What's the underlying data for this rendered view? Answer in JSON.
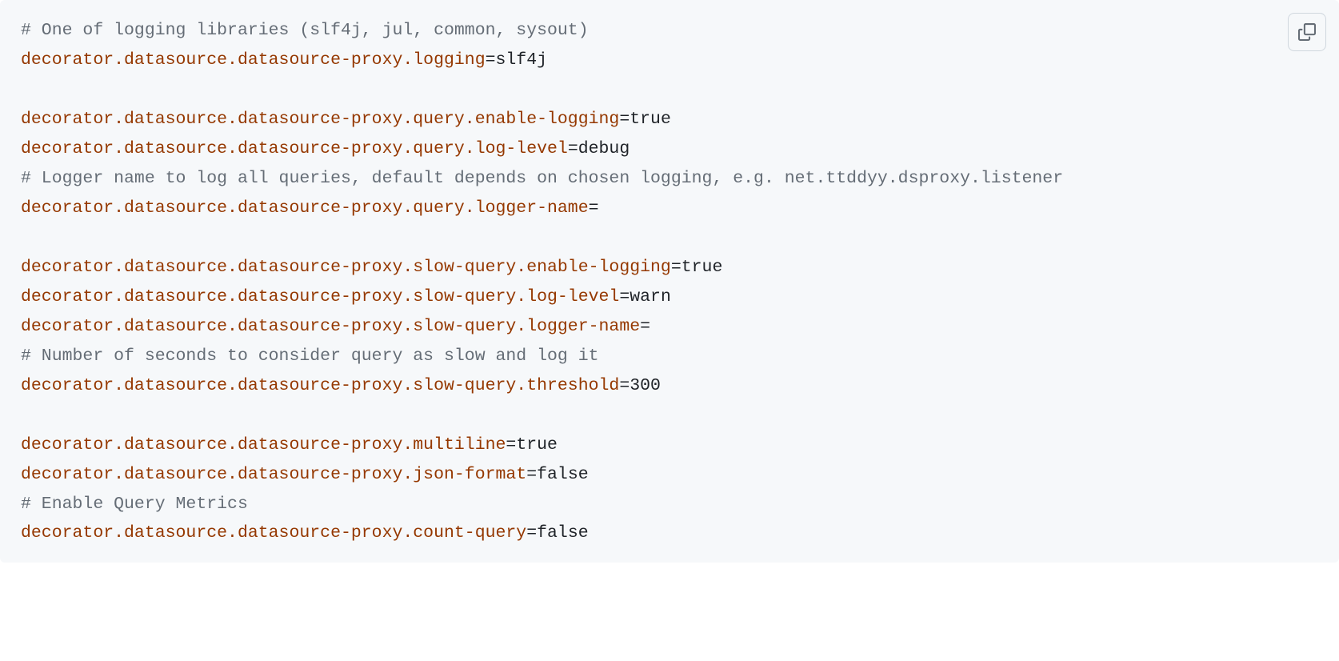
{
  "lines": [
    {
      "type": "comment",
      "text": "# One of logging libraries (slf4j, jul, common, sysout)"
    },
    {
      "type": "kv",
      "key": "decorator.datasource.datasource-proxy.logging",
      "value": "slf4j"
    },
    {
      "type": "blank"
    },
    {
      "type": "kv",
      "key": "decorator.datasource.datasource-proxy.query.enable-logging",
      "value": "true"
    },
    {
      "type": "kv",
      "key": "decorator.datasource.datasource-proxy.query.log-level",
      "value": "debug"
    },
    {
      "type": "comment",
      "text": "# Logger name to log all queries, default depends on chosen logging, e.g. net.ttddyy.dsproxy.listener"
    },
    {
      "type": "kv",
      "key": "decorator.datasource.datasource-proxy.query.logger-name",
      "value": ""
    },
    {
      "type": "blank"
    },
    {
      "type": "kv",
      "key": "decorator.datasource.datasource-proxy.slow-query.enable-logging",
      "value": "true"
    },
    {
      "type": "kv",
      "key": "decorator.datasource.datasource-proxy.slow-query.log-level",
      "value": "warn"
    },
    {
      "type": "kv",
      "key": "decorator.datasource.datasource-proxy.slow-query.logger-name",
      "value": ""
    },
    {
      "type": "comment",
      "text": "# Number of seconds to consider query as slow and log it"
    },
    {
      "type": "kv",
      "key": "decorator.datasource.datasource-proxy.slow-query.threshold",
      "value": "300"
    },
    {
      "type": "blank"
    },
    {
      "type": "kv",
      "key": "decorator.datasource.datasource-proxy.multiline",
      "value": "true"
    },
    {
      "type": "kv",
      "key": "decorator.datasource.datasource-proxy.json-format",
      "value": "false"
    },
    {
      "type": "comment",
      "text": "# Enable Query Metrics"
    },
    {
      "type": "kv",
      "key": "decorator.datasource.datasource-proxy.count-query",
      "value": "false"
    }
  ],
  "copy_label": "Copy"
}
